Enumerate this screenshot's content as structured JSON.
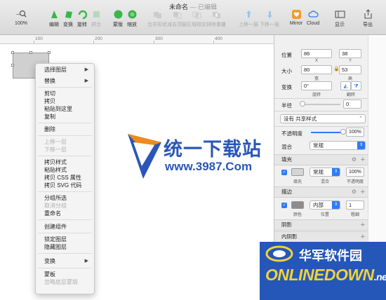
{
  "window": {
    "title": "未命名",
    "title_suffix": "— 已编辑"
  },
  "toolbar": {
    "zoom_label": "100%",
    "items": [
      {
        "label": "编辑",
        "icon": "edit-icon",
        "enabled": true
      },
      {
        "label": "变换",
        "icon": "transform-icon",
        "enabled": true
      },
      {
        "label": "旋转",
        "icon": "rotate-icon",
        "enabled": true
      },
      {
        "label": "拼合",
        "icon": "flatten-icon",
        "enabled": false
      },
      {
        "label": "蒙版",
        "icon": "mask-icon",
        "enabled": true
      },
      {
        "label": "缩放",
        "icon": "scale-icon",
        "enabled": true
      },
      {
        "label": "合并形状",
        "icon": "union-icon",
        "enabled": false
      },
      {
        "label": "减去顶层",
        "icon": "subtract-icon",
        "enabled": false
      },
      {
        "label": "区域相交",
        "icon": "intersect-icon",
        "enabled": false
      },
      {
        "label": "排除重叠",
        "icon": "difference-icon",
        "enabled": false
      },
      {
        "label": "上移一层",
        "icon": "forward-icon",
        "enabled": false
      },
      {
        "label": "下移一层",
        "icon": "backward-icon",
        "enabled": false
      },
      {
        "label": "Mirror",
        "icon": "mirror-icon",
        "enabled": true
      },
      {
        "label": "Cloud",
        "icon": "cloud-icon",
        "enabled": true
      },
      {
        "label": "显示",
        "icon": "view-icon",
        "enabled": true
      },
      {
        "label": "导出",
        "icon": "export-icon",
        "enabled": true
      }
    ]
  },
  "ruler": {
    "ticks": [
      "100",
      "200",
      "300",
      "400"
    ]
  },
  "context_menu": {
    "items": [
      {
        "label": "选择图层",
        "submenu": true,
        "enabled": true
      },
      {
        "label": "替换",
        "submenu": true,
        "enabled": true
      },
      {
        "label": "剪切",
        "enabled": true
      },
      {
        "label": "拷贝",
        "enabled": true
      },
      {
        "label": "粘贴到这里",
        "enabled": true
      },
      {
        "label": "复制",
        "enabled": true
      },
      {
        "label": "删除",
        "enabled": true
      },
      {
        "label": "上移一层",
        "enabled": false
      },
      {
        "label": "下移一层",
        "enabled": false
      },
      {
        "label": "拷贝样式",
        "enabled": true
      },
      {
        "label": "粘贴样式",
        "enabled": true
      },
      {
        "label": "拷贝 CSS 属性",
        "enabled": true
      },
      {
        "label": "拷贝 SVG 代码",
        "enabled": true
      },
      {
        "label": "分组所选",
        "enabled": true
      },
      {
        "label": "取消分组",
        "enabled": false
      },
      {
        "label": "重命名",
        "enabled": true
      },
      {
        "label": "创建组件",
        "enabled": true
      },
      {
        "label": "锁定图层",
        "enabled": true
      },
      {
        "label": "隐藏图层",
        "enabled": true
      },
      {
        "label": "变换",
        "submenu": true,
        "enabled": true
      },
      {
        "label": "蒙板",
        "enabled": true
      },
      {
        "label": "忽略底层蒙版",
        "enabled": false
      }
    ]
  },
  "watermark": {
    "title": "统一下载站",
    "url": "www.3987.Com"
  },
  "inspector": {
    "position_label": "位置",
    "x_value": "86",
    "y_value": "38",
    "x_label": "X",
    "y_label": "Y",
    "size_label": "大小",
    "width_value": "80",
    "height_value": "53",
    "width_label": "宽",
    "height_label": "高",
    "transform_label": "变换",
    "rotation_value": "0°",
    "rotate_label": "旋转",
    "flip_label": "翻转",
    "radius_label": "半径",
    "radius_value": "0",
    "shared_style": "没有 共享样式",
    "opacity_label": "不透明度",
    "opacity_value": "100%",
    "opacity_fraction": 1.0,
    "blend_label": "混合",
    "blend_value": "常规",
    "fill_section": "填充",
    "fill_blend": "常规",
    "fill_opacity": "100%",
    "fill_color": "#d5d5d5",
    "fill_color_label": "填充",
    "fill_blend_label": "混合",
    "fill_opacity_label": "不透明度",
    "border_section": "描边",
    "border_position": "内部",
    "border_width": "1",
    "border_color": "#8c8c8c",
    "border_color_label": "颜色",
    "border_position_label": "位置",
    "border_width_label": "粗细",
    "shadow_section": "阴影",
    "inner_shadow_section": "内阴影"
  },
  "brand": {
    "cn": "华军软件园",
    "en": "ONLINEDOWN",
    "tld": ".net"
  },
  "colors": {
    "accent": "#2e7bf6",
    "watermark_blue": "#2a56b8",
    "brand_blue": "#2457b8",
    "brand_yellow": "#f2d23a"
  }
}
